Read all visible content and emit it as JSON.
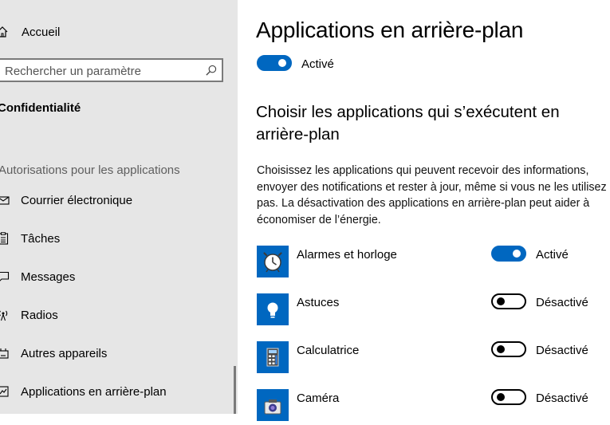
{
  "sidebar": {
    "home_label": "Accueil",
    "search_placeholder": "Rechercher un paramètre",
    "section_title": "Confidentialité",
    "group_label": "Autorisations pour les applications",
    "items": [
      {
        "label": "Courrier électronique",
        "icon": "mail-icon"
      },
      {
        "label": "Tâches",
        "icon": "tasks-icon"
      },
      {
        "label": "Messages",
        "icon": "message-icon"
      },
      {
        "label": "Radios",
        "icon": "radio-icon"
      },
      {
        "label": "Autres appareils",
        "icon": "devices-icon"
      },
      {
        "label": "Applications en arrière-plan",
        "icon": "background-apps-icon",
        "selected": true
      }
    ]
  },
  "main": {
    "title": "Applications en arrière-plan",
    "master_toggle": {
      "state": "on",
      "label": "Activé"
    },
    "subheading": "Choisir les applications qui s’exécutent en arrière-plan",
    "description": "Choisissez les applications qui peuvent recevoir des informations, envoyer des notifications et rester à jour, même si vous ne les utilisez pas. La désactivation des applications en arrière-plan peut aider à économiser de l’énergie.",
    "apps": [
      {
        "name": "Alarmes et horloge",
        "state": "on",
        "status": "Activé",
        "icon": "alarm-clock-icon"
      },
      {
        "name": "Astuces",
        "state": "off",
        "status": "Désactivé",
        "icon": "lightbulb-icon"
      },
      {
        "name": "Calculatrice",
        "state": "off",
        "status": "Désactivé",
        "icon": "calculator-icon"
      },
      {
        "name": "Caméra",
        "state": "off",
        "status": "Désactivé",
        "icon": "camera-icon"
      }
    ]
  },
  "colors": {
    "accent": "#0067c0",
    "sidebar_bg": "#e6e6e6",
    "main_bg": "#ffffff"
  }
}
